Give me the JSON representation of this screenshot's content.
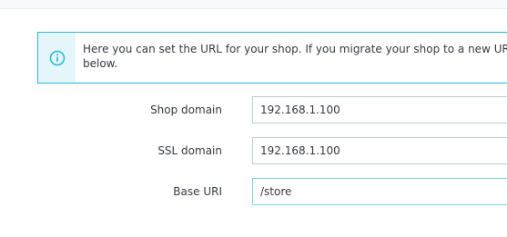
{
  "alert": {
    "line1": "Here you can set the URL for your shop. If you migrate your shop to a new URL, remember to change the values",
    "line2": "below.",
    "icon": "info-circle-icon",
    "accent_color": "#25b9d7"
  },
  "form": {
    "shop_domain": {
      "label": "Shop domain",
      "value": "192.168.1.100"
    },
    "ssl_domain": {
      "label": "SSL domain",
      "value": "192.168.1.100"
    },
    "base_uri": {
      "label": "Base URI",
      "value": "/store"
    }
  }
}
